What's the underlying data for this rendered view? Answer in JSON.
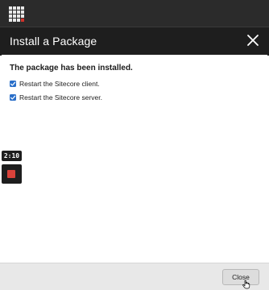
{
  "dialog": {
    "title": "Install a Package",
    "message": "The package has been installed.",
    "options": [
      {
        "label": "Restart the Sitecore client.",
        "checked": true
      },
      {
        "label": "Restart the Sitecore server.",
        "checked": true
      }
    ],
    "close_button_label": "Close"
  },
  "recorder": {
    "timer": "2:10"
  },
  "icons": {
    "app": "app-grid-icon",
    "dialog_close": "close-icon",
    "checkbox": "checkmark-icon",
    "stop": "stop-icon",
    "cursor": "hand-pointer-icon"
  },
  "colors": {
    "header_bg": "#1e1e1e",
    "checkbox_blue": "#2a6fc9",
    "stop_red": "#d9423a",
    "footer_bg": "#e8e8e8"
  }
}
